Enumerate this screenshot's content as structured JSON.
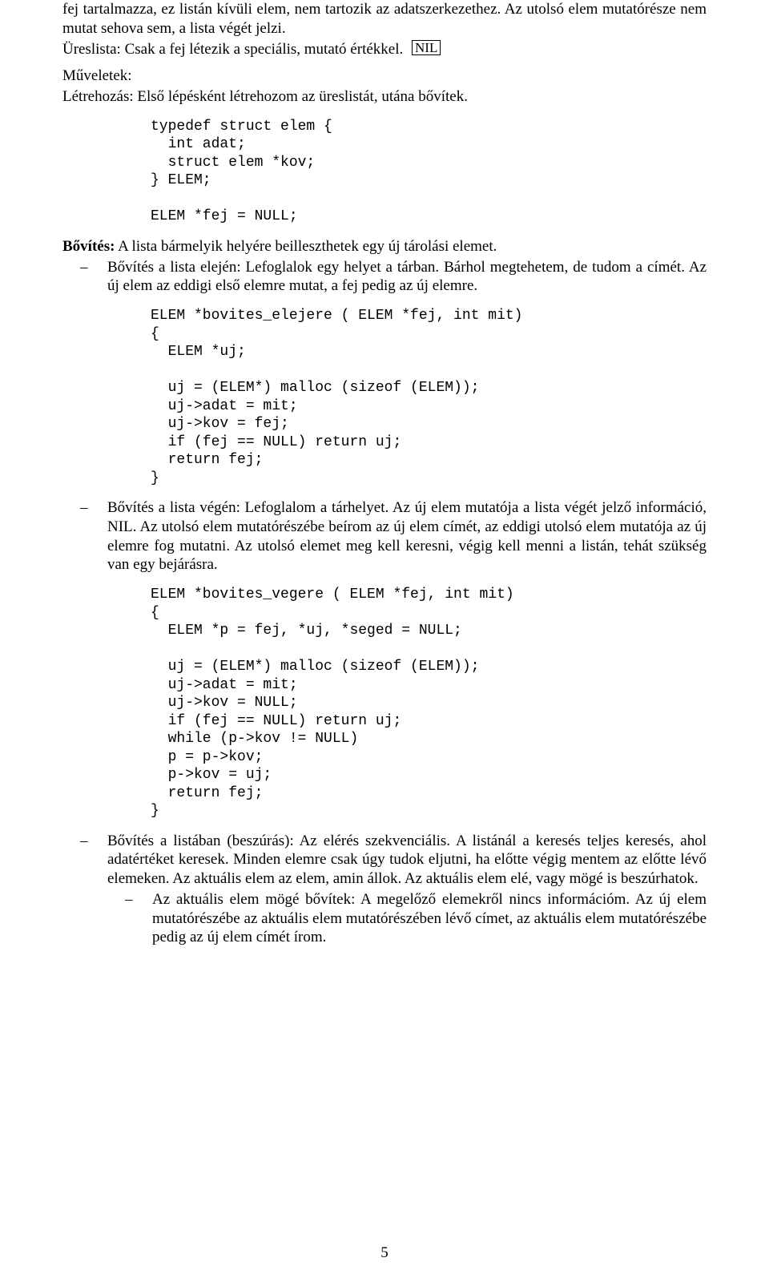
{
  "intro": {
    "p1": "fej tartalmazza, ez listán kívüli elem, nem tartozik az adatszerkezethez. Az utolsó elem mutatórésze nem mutat sehova sem, a lista végét jelzi.",
    "p2_prefix": "Üreslista: Csak a fej létezik a speciális, mutató értékkel.",
    "nil_label": "NIL",
    "ops_label": "Műveletek:",
    "create_prefix": "Létrehozás:",
    "create_rest": " Első lépésként létrehozom az üreslistát, utána bővítek."
  },
  "code": {
    "typedef": "typedef struct elem {\n  int adat;\n  struct elem *kov;\n} ELEM;\n\nELEM *fej = NULL;",
    "bov_elejere": "ELEM *bovites_elejere ( ELEM *fej, int mit)\n{\n  ELEM *uj;\n\n  uj = (ELEM*) malloc (sizeof (ELEM));\n  uj->adat = mit;\n  uj->kov = fej;\n  if (fej == NULL) return uj;\n  return fej;\n}",
    "bov_vegere": "ELEM *bovites_vegere ( ELEM *fej, int mit)\n{\n  ELEM *p = fej, *uj, *seged = NULL;\n\n  uj = (ELEM*) malloc (sizeof (ELEM));\n  uj->adat = mit;\n  uj->kov = NULL;\n  if (fej == NULL) return uj;\n  while (p->kov != NULL)\n  p = p->kov;\n  p->kov = uj;\n  return fej;\n}"
  },
  "bovites": {
    "intro_bold": "Bővítés:",
    "intro_rest": " A lista bármelyik helyére beilleszthetek egy új tárolási elemet.",
    "b1": "Bővítés a lista elején: Lefoglalok egy helyet a tárban. Bárhol megtehetem, de tudom a címét. Az új elem az eddigi első elemre mutat, a fej pedig az új elemre.",
    "b2": "Bővítés a lista végén: Lefoglalom a tárhelyet. Az új elem mutatója a lista végét jelző információ, NIL. Az utolsó elem mutatórészébe beírom az új elem címét, az eddigi utolsó elem mutatója az új elemre fog mutatni. Az utolsó elemet meg kell keresni, végig kell menni a listán, tehát szükség van egy bejárásra.",
    "b3": "Bővítés a listában (beszúrás): Az elérés szekvenciális. A listánál a keresés teljes keresés, ahol adatértéket keresek. Minden elemre csak úgy tudok eljutni, ha előtte végig mentem az előtte lévő elemeken. Az aktuális elem az elem, amin állok. Az aktuális elem elé, vagy mögé is beszúrhatok.",
    "b3_sub": "Az aktuális elem mögé bővítek: A megelőző elemekről nincs információm. Az új elem mutatórészébe az aktuális elem mutatórészében lévő címet, az aktuális elem mutatórészébe pedig az új elem címét írom."
  },
  "misc": {
    "dash": "–",
    "page_number": "5"
  }
}
